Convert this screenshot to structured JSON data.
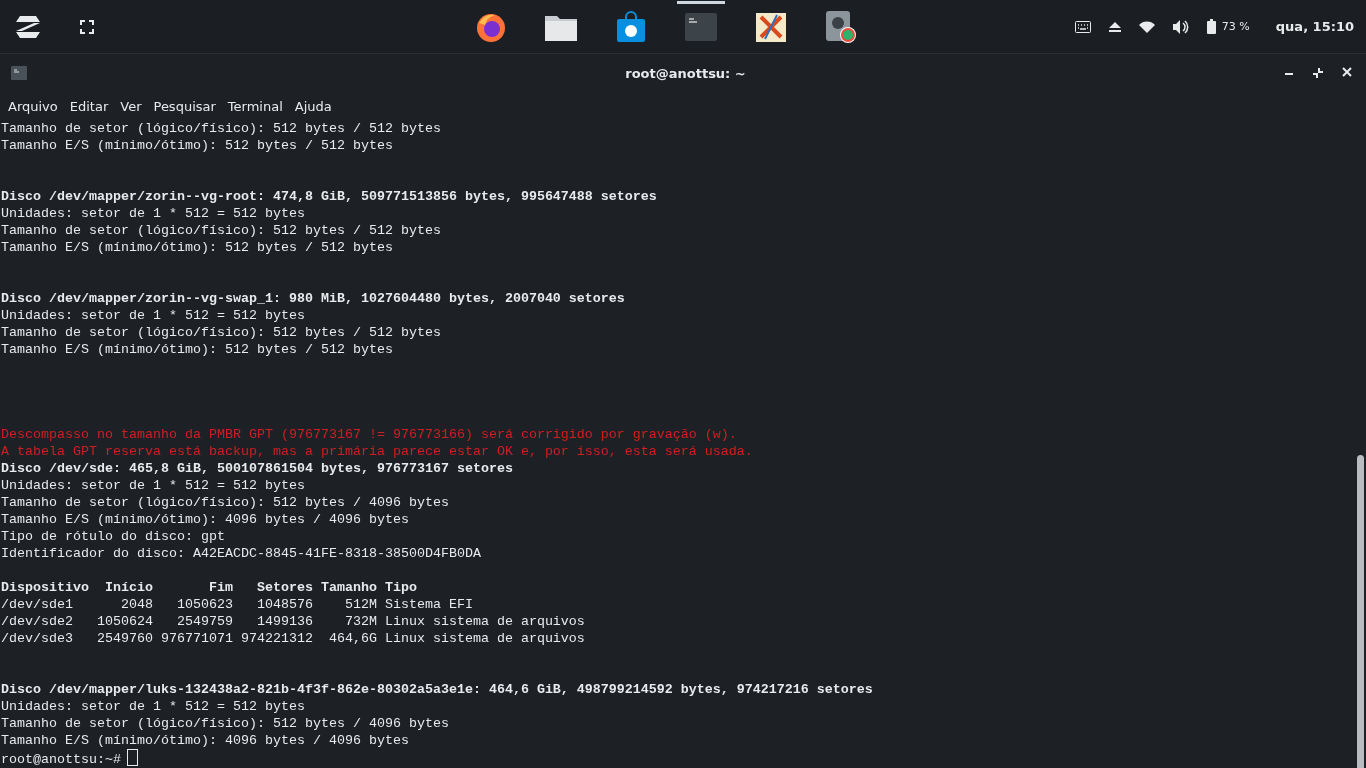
{
  "panel": {
    "apps": [
      {
        "kind": "browser",
        "selected": false
      },
      {
        "kind": "files",
        "selected": false
      },
      {
        "kind": "store",
        "selected": false
      },
      {
        "kind": "terminal",
        "selected": true
      },
      {
        "kind": "editor",
        "selected": false
      },
      {
        "kind": "disk",
        "selected": false
      }
    ],
    "battery": "73 %",
    "clock": "qua, 15:10"
  },
  "window": {
    "title": "root@anottsu: ~",
    "menu": [
      "Arquivo",
      "Editar",
      "Ver",
      "Pesquisar",
      "Terminal",
      "Ajuda"
    ],
    "lines": [
      {
        "kind": "normal",
        "text": "Tamanho de setor (lógico/físico): 512 bytes / 512 bytes"
      },
      {
        "kind": "normal",
        "text": "Tamanho E/S (mínimo/ótimo): 512 bytes / 512 bytes"
      },
      {
        "kind": "blank"
      },
      {
        "kind": "blank"
      },
      {
        "kind": "bold",
        "text": "Disco /dev/mapper/zorin--vg-root: 474,8 GiB, 509771513856 bytes, 995647488 setores"
      },
      {
        "kind": "normal",
        "text": "Unidades: setor de 1 * 512 = 512 bytes"
      },
      {
        "kind": "normal",
        "text": "Tamanho de setor (lógico/físico): 512 bytes / 512 bytes"
      },
      {
        "kind": "normal",
        "text": "Tamanho E/S (mínimo/ótimo): 512 bytes / 512 bytes"
      },
      {
        "kind": "blank"
      },
      {
        "kind": "blank"
      },
      {
        "kind": "bold",
        "text": "Disco /dev/mapper/zorin--vg-swap_1: 980 MiB, 1027604480 bytes, 2007040 setores"
      },
      {
        "kind": "normal",
        "text": "Unidades: setor de 1 * 512 = 512 bytes"
      },
      {
        "kind": "normal",
        "text": "Tamanho de setor (lógico/físico): 512 bytes / 512 bytes"
      },
      {
        "kind": "normal",
        "text": "Tamanho E/S (mínimo/ótimo): 512 bytes / 512 bytes"
      },
      {
        "kind": "blank"
      },
      {
        "kind": "blank"
      },
      {
        "kind": "blank"
      },
      {
        "kind": "blank"
      },
      {
        "kind": "error",
        "text": "Descompasso no tamanho da PMBR GPT (976773167 != 976773166) será corrigido por gravação (w)."
      },
      {
        "kind": "error",
        "text": "A tabela GPT reserva está backup, mas a primária parece estar OK e, por isso, esta será usada."
      },
      {
        "kind": "bold",
        "text": "Disco /dev/sde: 465,8 GiB, 500107861504 bytes, 976773167 setores"
      },
      {
        "kind": "normal",
        "text": "Unidades: setor de 1 * 512 = 512 bytes"
      },
      {
        "kind": "normal",
        "text": "Tamanho de setor (lógico/físico): 512 bytes / 4096 bytes"
      },
      {
        "kind": "normal",
        "text": "Tamanho E/S (mínimo/ótimo): 4096 bytes / 4096 bytes"
      },
      {
        "kind": "normal",
        "text": "Tipo de rótulo do disco: gpt"
      },
      {
        "kind": "normal",
        "text": "Identificador do disco: A42EACDC-8845-41FE-8318-38500D4FB0DA"
      },
      {
        "kind": "blank"
      },
      {
        "kind": "bold",
        "text": "Dispositivo  Início       Fim   Setores Tamanho Tipo"
      },
      {
        "kind": "normal",
        "text": "/dev/sde1      2048   1050623   1048576    512M Sistema EFI"
      },
      {
        "kind": "normal",
        "text": "/dev/sde2   1050624   2549759   1499136    732M Linux sistema de arquivos"
      },
      {
        "kind": "normal",
        "text": "/dev/sde3   2549760 976771071 974221312  464,6G Linux sistema de arquivos"
      },
      {
        "kind": "blank"
      },
      {
        "kind": "blank"
      },
      {
        "kind": "bold",
        "text": "Disco /dev/mapper/luks-132438a2-821b-4f3f-862e-80302a5a3e1e: 464,6 GiB, 498799214592 bytes, 974217216 setores"
      },
      {
        "kind": "normal",
        "text": "Unidades: setor de 1 * 512 = 512 bytes"
      },
      {
        "kind": "normal",
        "text": "Tamanho de setor (lógico/físico): 512 bytes / 4096 bytes"
      },
      {
        "kind": "normal",
        "text": "Tamanho E/S (mínimo/ótimo): 4096 bytes / 4096 bytes"
      }
    ],
    "prompt": "root@anottsu:~#"
  }
}
